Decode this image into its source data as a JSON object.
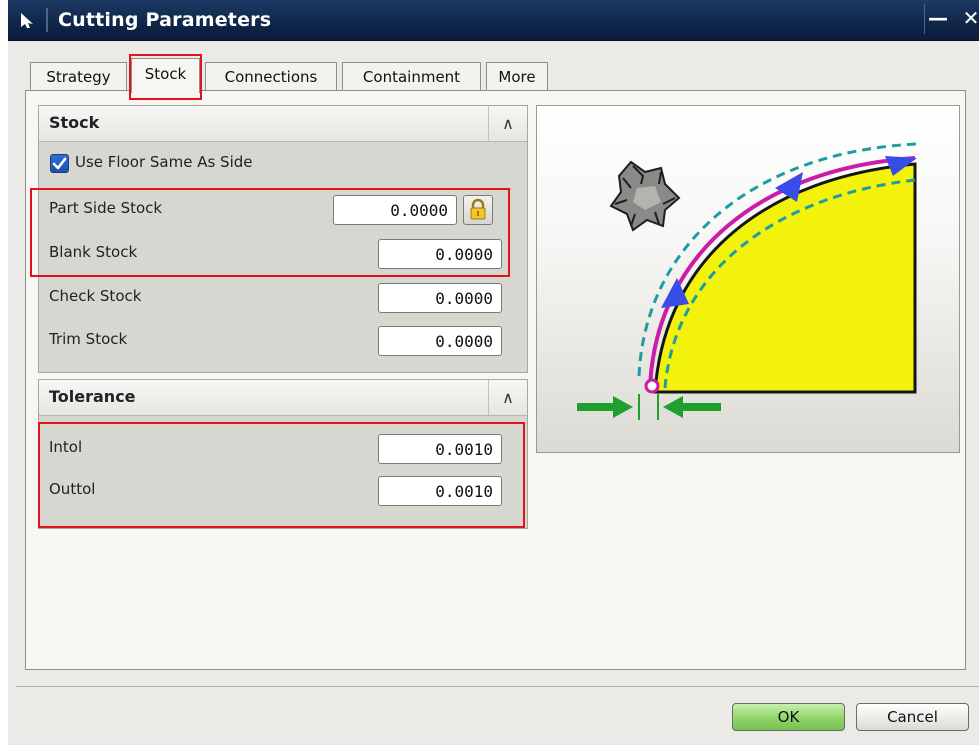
{
  "window": {
    "title": "Cutting Parameters",
    "minimize_glyph": "—",
    "close_glyph": "✕"
  },
  "tabs": [
    {
      "label": "Strategy",
      "active": false
    },
    {
      "label": "Stock",
      "active": true
    },
    {
      "label": "Connections",
      "active": false
    },
    {
      "label": "Containment",
      "active": false
    },
    {
      "label": "More",
      "active": false
    }
  ],
  "stock_section": {
    "title": "Stock",
    "collapse_glyph": "∧",
    "use_floor_same_as_side": {
      "label": "Use Floor Same As Side",
      "checked": true
    },
    "fields": {
      "part_side_stock": {
        "label": "Part Side Stock",
        "value": "0.0000"
      },
      "blank_stock": {
        "label": "Blank Stock",
        "value": "0.0000"
      },
      "check_stock": {
        "label": "Check Stock",
        "value": "0.0000"
      },
      "trim_stock": {
        "label": "Trim Stock",
        "value": "0.0000"
      }
    }
  },
  "tolerance_section": {
    "title": "Tolerance",
    "collapse_glyph": "∧",
    "fields": {
      "intol": {
        "label": "Intol",
        "value": "0.0010"
      },
      "outtol": {
        "label": "Outtol",
        "value": "0.0010"
      }
    }
  },
  "buttons": {
    "ok": "OK",
    "cancel": "Cancel"
  },
  "colors": {
    "highlight_red": "#e0141a",
    "titlebar": "#0f2548",
    "part_yellow": "#f2f20a",
    "toolpath_magenta": "#cc1ba8",
    "arrow_blue": "#3a4ce8",
    "stock_teal": "#1c9ea0",
    "dimension_green": "#1fa02e",
    "ok_green": "#8fd56a"
  },
  "icons": {
    "title": "pointer-arrow-icon",
    "lock": "lock-icon",
    "checkbox": "checkmark-icon",
    "preview": "cutter-tool-icon"
  }
}
